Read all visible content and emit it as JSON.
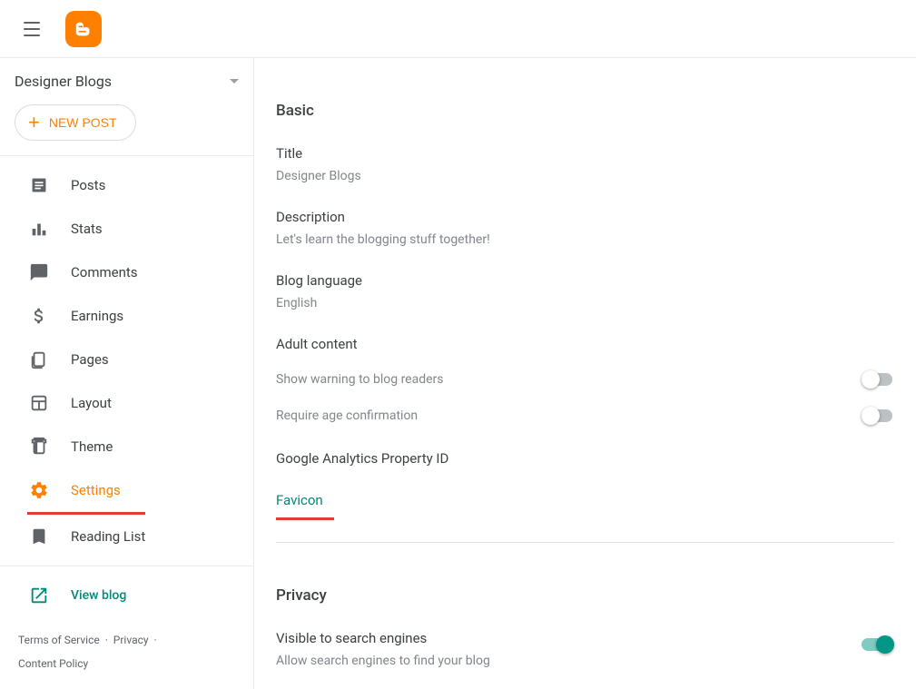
{
  "blogSelector": {
    "title": "Designer Blogs"
  },
  "newPost": {
    "label": "NEW POST"
  },
  "nav": {
    "posts": "Posts",
    "stats": "Stats",
    "comments": "Comments",
    "earnings": "Earnings",
    "pages": "Pages",
    "layout": "Layout",
    "theme": "Theme",
    "settings": "Settings",
    "readingList": "Reading List",
    "viewBlog": "View blog"
  },
  "footer": {
    "terms": "Terms of Service",
    "privacy": "Privacy",
    "contentPolicy": "Content Policy"
  },
  "sections": {
    "basic": {
      "heading": "Basic",
      "title": {
        "label": "Title",
        "value": "Designer Blogs"
      },
      "description": {
        "label": "Description",
        "value": "Let's learn the blogging stuff together!"
      },
      "blogLanguage": {
        "label": "Blog language",
        "value": "English"
      },
      "adultContent": {
        "label": "Adult content",
        "showWarning": "Show warning to blog readers",
        "requireAge": "Require age confirmation"
      },
      "gaPropertyId": {
        "label": "Google Analytics Property ID"
      },
      "favicon": {
        "label": "Favicon"
      }
    },
    "privacy": {
      "heading": "Privacy",
      "visible": {
        "label": "Visible to search engines",
        "desc": "Allow search engines to find your blog"
      }
    }
  }
}
